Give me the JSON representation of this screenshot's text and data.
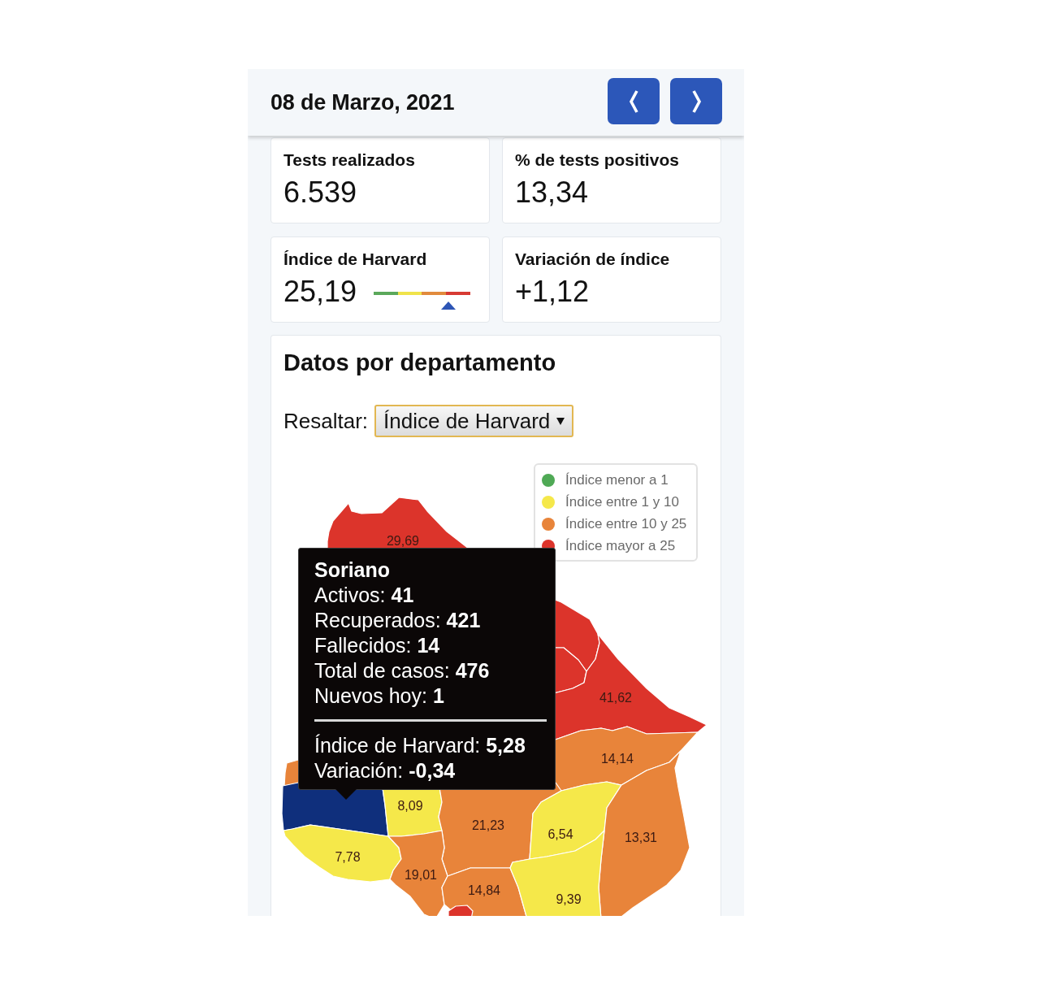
{
  "header": {
    "date": "08 de Marzo, 2021",
    "buttons": [
      {
        "kind": "previous"
      },
      {
        "kind": "next"
      }
    ]
  },
  "stats": [
    {
      "kind": "plain",
      "label": "Tests realizados",
      "value": "6.539"
    },
    {
      "kind": "plain",
      "label": "% de tests positivos",
      "value": "13,34"
    },
    {
      "kind": "gauge",
      "label": "Índice de Harvard",
      "value": "25,19",
      "level": 0.77
    },
    {
      "kind": "plain",
      "label": "Variación de índice",
      "value": "+1,12"
    }
  ],
  "department_panel": {
    "title": "Datos por departamento",
    "highlight": {
      "label": "Resaltar:",
      "value": "Índice de Harvard"
    },
    "legend": [
      {
        "label": "Índice menor a 1",
        "color": "#4fa955"
      },
      {
        "label": "Índice entre 1 y 10",
        "color": "#f5e84a"
      },
      {
        "label": "Índice entre 10 y 25",
        "color": "#e8843a"
      },
      {
        "label": "Índice mayor a 25",
        "color": "#dc342b"
      }
    ],
    "map": {
      "departments": [
        {
          "value": "29,69",
          "color": "#dc342b",
          "selected": false
        },
        {
          "color": "#dc342b",
          "selected": false
        },
        {
          "color": "#dc342b",
          "selected": false
        },
        {
          "value": "41,62",
          "color": "#dc342b",
          "selected": false
        },
        {
          "color": "#e8843a",
          "selected": false
        },
        {
          "value": "14,14",
          "color": "#e8843a",
          "selected": false
        },
        {
          "selected": true
        },
        {
          "value": "8,09",
          "color": "#f5e84a",
          "selected": false
        },
        {
          "value": "21,23",
          "color": "#e8843a",
          "selected": false
        },
        {
          "value": "6,54",
          "color": "#f5e84a",
          "selected": false
        },
        {
          "value": "13,31",
          "color": "#e8843a",
          "selected": false
        },
        {
          "value": "7,78",
          "color": "#f5e84a",
          "selected": false
        },
        {
          "value": "19,01",
          "color": "#e8843a",
          "selected": false
        },
        {
          "value": "14,84",
          "color": "#e8843a",
          "selected": false
        },
        {
          "value": "9,39",
          "color": "#f5e84a",
          "selected": false
        },
        {
          "color": "#dc342b",
          "selected": false
        }
      ]
    },
    "tooltip": {
      "title": "Soriano",
      "lines": [
        "Activos: **41**",
        "Recuperados: **421**",
        "Fallecidos: **14**",
        "Total de casos: **476**",
        "Nuevos hoy: **1**"
      ],
      "index_lines": [
        "Índice de Harvard: **5,28**",
        "Variación: **-0,34**"
      ]
    }
  }
}
